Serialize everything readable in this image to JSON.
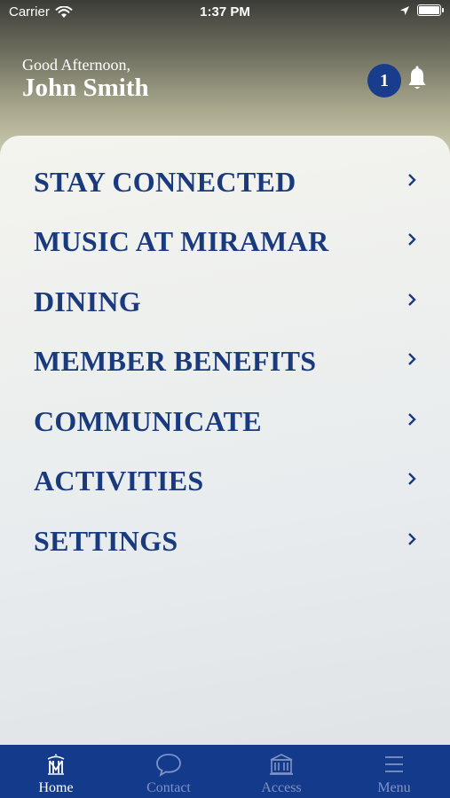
{
  "status_bar": {
    "carrier": "Carrier",
    "time": "1:37 PM",
    "icons": [
      "wifi-icon",
      "location-arrow-icon",
      "battery-icon"
    ]
  },
  "header": {
    "greeting": "Good Afternoon,",
    "user_name": "John Smith",
    "notification_count": "1",
    "icons": [
      "bell-icon"
    ]
  },
  "menu": {
    "items": [
      {
        "label": "STAY CONNECTED"
      },
      {
        "label": "MUSIC AT MIRAMAR"
      },
      {
        "label": "DINING"
      },
      {
        "label": "MEMBER BENEFITS"
      },
      {
        "label": "COMMUNICATE"
      },
      {
        "label": "ACTIVITIES"
      },
      {
        "label": "SETTINGS"
      }
    ],
    "item_icon": "chevron-right-icon"
  },
  "tab_bar": {
    "tabs": [
      {
        "label": "Home",
        "icon": "crest-icon",
        "active": true
      },
      {
        "label": "Contact",
        "icon": "chat-bubble-icon",
        "active": false
      },
      {
        "label": "Access",
        "icon": "building-icon",
        "active": false
      },
      {
        "label": "Menu",
        "icon": "hamburger-icon",
        "active": false
      }
    ]
  },
  "colors": {
    "brand_blue": "#143a8c",
    "menu_text": "#1a3a7e",
    "badge": "#1a3c8c",
    "inactive_tab": "#7f93c5"
  }
}
